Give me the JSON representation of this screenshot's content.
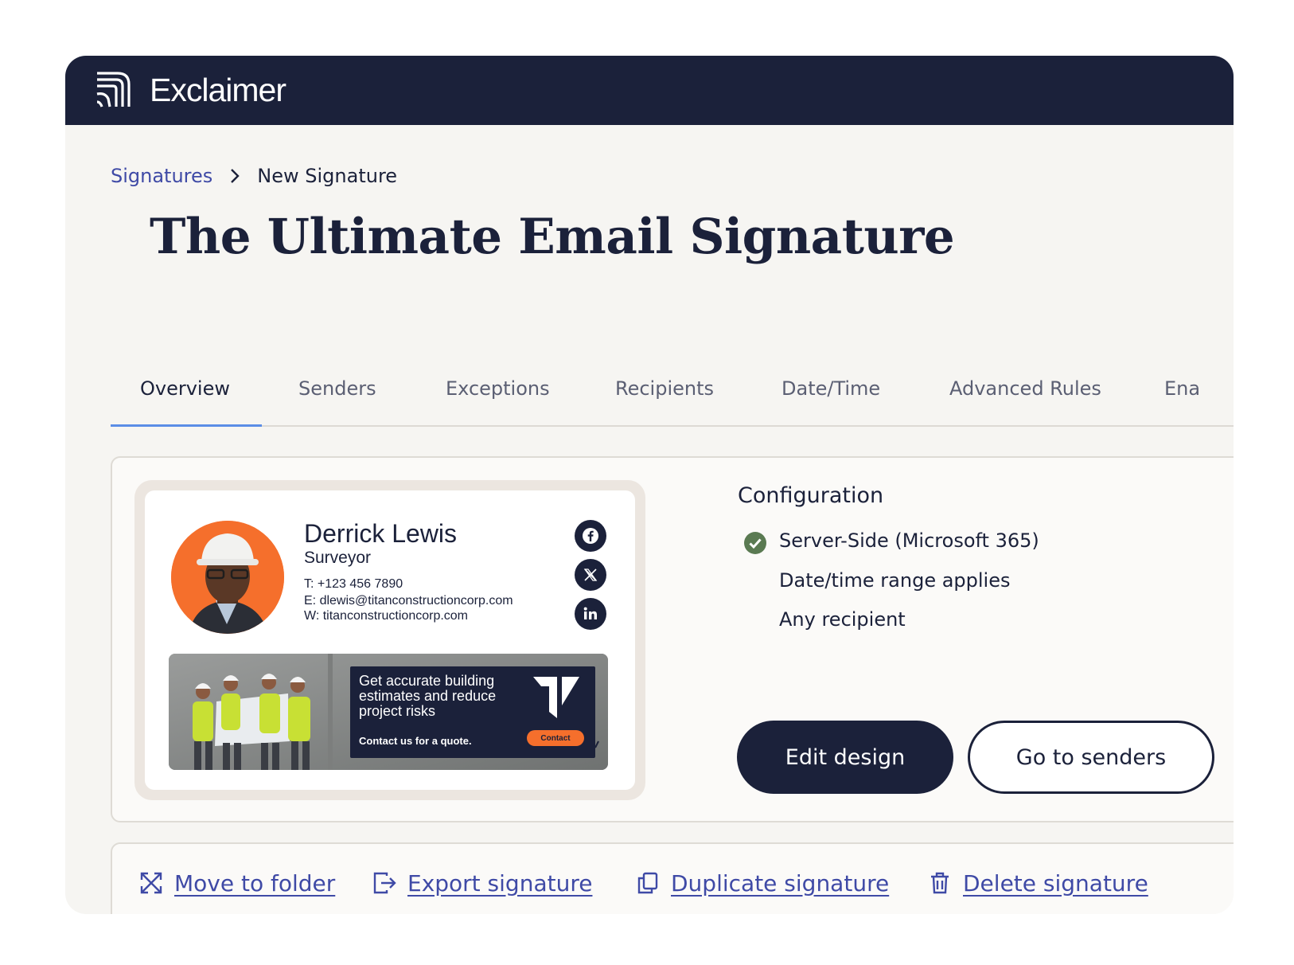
{
  "app": {
    "brand": "Exclaimer"
  },
  "breadcrumb": {
    "parent": "Signatures",
    "current": "New Signature"
  },
  "page": {
    "title": "The Ultimate Email Signature"
  },
  "tabs": [
    {
      "label": "Overview",
      "active": true
    },
    {
      "label": "Senders",
      "active": false
    },
    {
      "label": "Exceptions",
      "active": false
    },
    {
      "label": "Recipients",
      "active": false
    },
    {
      "label": "Date/Time",
      "active": false
    },
    {
      "label": "Advanced Rules",
      "active": false
    },
    {
      "label": "Ena",
      "active": false
    }
  ],
  "signature_preview": {
    "name": "Derrick Lewis",
    "role": "Surveyor",
    "phone": "T: +123 456 7890",
    "email": "E: dlewis@titanconstructioncorp.com",
    "web": "W: titanconstructioncorp.com",
    "socials": [
      "facebook-icon",
      "x-icon",
      "linkedin-icon"
    ],
    "banner": {
      "headline": "Get accurate building estimates and reduce project risks",
      "cta_text": "Contact us for a quote.",
      "button": "Contact"
    }
  },
  "configuration": {
    "title": "Configuration",
    "items": [
      {
        "text": "Server-Side (Microsoft 365)",
        "status": "check-icon"
      },
      {
        "text": "Date/time range applies"
      },
      {
        "text": "Any recipient"
      }
    ]
  },
  "buttons": {
    "edit_design": "Edit design",
    "go_to_senders": "Go to senders"
  },
  "actions": [
    {
      "label": "Move to folder",
      "icon": "move-icon"
    },
    {
      "label": "Export signature",
      "icon": "export-icon"
    },
    {
      "label": "Duplicate signature",
      "icon": "duplicate-icon"
    },
    {
      "label": "Delete signature",
      "icon": "trash-icon"
    }
  ],
  "colors": {
    "navy": "#1b213a",
    "link": "#3f4aa6",
    "accent_orange": "#f56f2c",
    "tab_underline": "#5b8de6",
    "check_green": "#5a7a52"
  }
}
